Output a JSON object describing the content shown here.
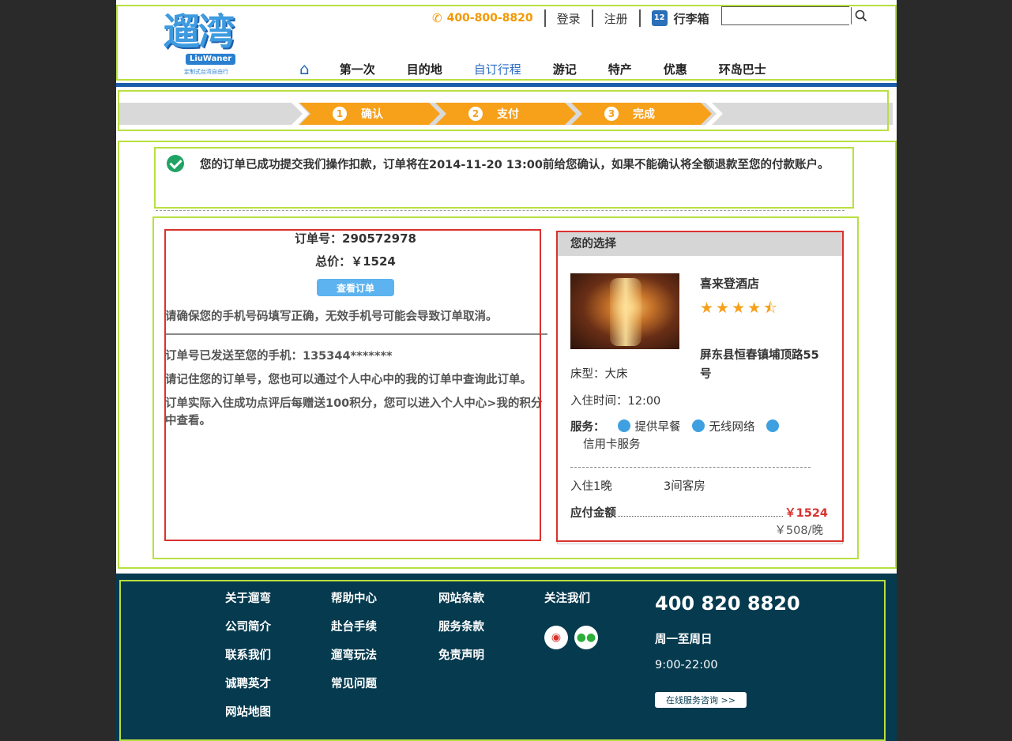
{
  "header": {
    "logo_text": "遛湾",
    "logo_en": "LiuWaner",
    "logo_sub": "定制式台湾自由行",
    "phone": "400-800-8820",
    "login": "登录",
    "register": "注册",
    "bag_count": "12",
    "bag_label": "行李箱",
    "search_value": ""
  },
  "nav": {
    "items": [
      "第一次",
      "目的地",
      "自订行程",
      "游记",
      "特产",
      "优惠",
      "环岛巴士"
    ],
    "active_index": 2
  },
  "steps": [
    {
      "num": "1",
      "label": "确认"
    },
    {
      "num": "2",
      "label": "支付"
    },
    {
      "num": "3",
      "label": "完成"
    }
  ],
  "message": "您的订单已成功提交我们操作扣款，订单将在2014-11-20 13:00前给您确认，如果不能确认将全额退款至您的付款账户。",
  "order": {
    "order_no_label": "订单号：290572978",
    "total_label": "总价：￥1524",
    "view_button": "查看订单",
    "warning": "请确保您的手机号码填写正确，无效手机号可能会导致订单取消。",
    "sent_to": "订单号已发送至您的手机：135344*******",
    "remember": "请记住您的订单号，您也可以通过个人中心中的我的订单中查询此订单。",
    "points": "订单实际入住成功点评后每赠送100积分，您可以进入个人中心>我的积分中查看。"
  },
  "choice": {
    "title": "您的选择",
    "hotel_name": "喜来登酒店",
    "stars": "★★★★⯪",
    "star_rating": 4.5,
    "address": "屏东县恒春镇埔顶路55号",
    "bed": "床型：大床",
    "checkin": "入住时间：12:00",
    "services_label": "服务：",
    "services": [
      "提供早餐",
      "无线网络",
      "信用卡服务"
    ],
    "nights": "入住1晚",
    "rooms": "3间客房",
    "pay_label": "应付金额",
    "pay_amount": "￥1524",
    "per_night": "￥508/晚"
  },
  "footer": {
    "col1": [
      "关于遛弯",
      "公司简介",
      "联系我们",
      "诚聘英才",
      "网站地图"
    ],
    "col2": [
      "帮助中心",
      "赴台手续",
      "遛弯玩法",
      "常见问题"
    ],
    "col3": [
      "网站条款",
      "服务条款",
      "免责声明"
    ],
    "follow": "关注我们",
    "hotline": "400 820 8820",
    "days": "周一至周日",
    "hours": "9:00-22:00",
    "consult_button": "在线服务咨询 >>"
  },
  "colors": {
    "brand_blue": "#1a5dab",
    "step_orange": "#f7a01a",
    "footer_bg": "#053a4f",
    "price_red": "#d9322e",
    "success_green": "#21a366"
  }
}
